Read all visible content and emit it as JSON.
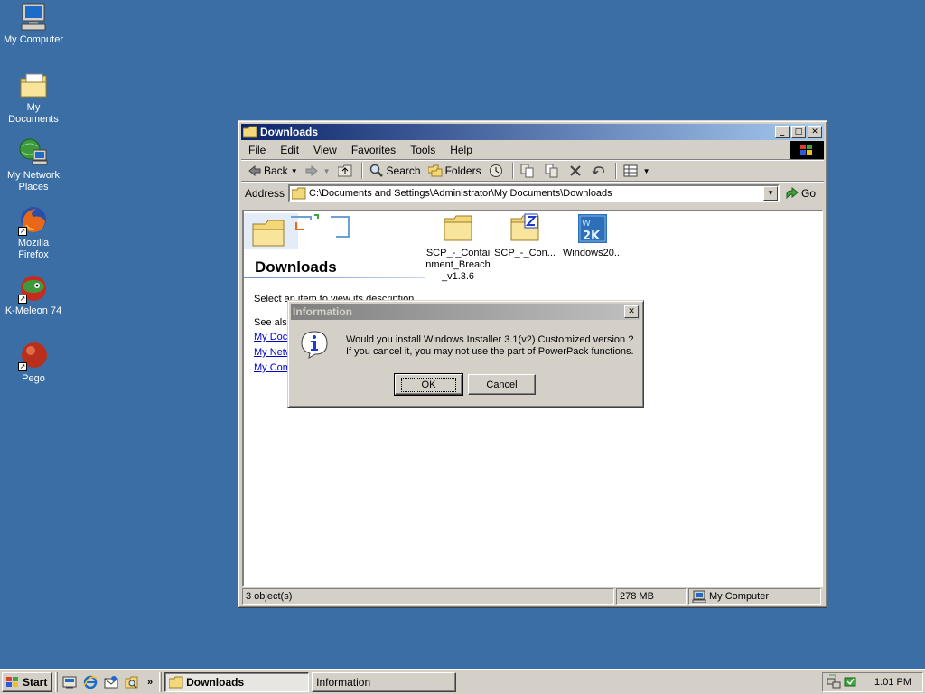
{
  "desktop": {
    "icons": [
      {
        "label": "My Computer",
        "icon": "computer-icon"
      },
      {
        "label": "My Documents",
        "icon": "documents-folder-icon"
      },
      {
        "label": "My Network Places",
        "icon": "network-icon"
      },
      {
        "label": "Mozilla Firefox",
        "icon": "firefox-icon"
      },
      {
        "label": "K-Meleon 74",
        "icon": "kmeleon-icon"
      },
      {
        "label": "Pego",
        "icon": "pego-icon"
      }
    ],
    "background": "#3a6ea5"
  },
  "window": {
    "title": "Downloads",
    "menu": [
      "File",
      "Edit",
      "View",
      "Favorites",
      "Tools",
      "Help"
    ],
    "toolbar": {
      "back": "Back",
      "search": "Search",
      "folders": "Folders"
    },
    "address": {
      "label": "Address",
      "value": "C:\\Documents and Settings\\Administrator\\My Documents\\Downloads",
      "go": "Go"
    },
    "pane": {
      "title": "Downloads",
      "description": "Select an item to view its description.",
      "see_also": "See also:",
      "links": [
        "My Documents",
        "My Network Places",
        "My Computer"
      ]
    },
    "files": [
      {
        "label": "SCP_-_Containment_Breach_v1.3.6",
        "lines": [
          "SCP_-_Contai",
          "nment_Breach",
          "_v1.3.6"
        ],
        "icon": "folder-icon"
      },
      {
        "label": "SCP_-_Con...",
        "lines": [
          "SCP_-_Con..."
        ],
        "icon": "zip-folder-icon"
      },
      {
        "label": "Windows20...",
        "lines": [
          "Windows20..."
        ],
        "icon": "windows-installer-icon"
      }
    ],
    "status": {
      "objects": "3 object(s)",
      "size": "278 MB",
      "zone": "My Computer"
    }
  },
  "dialog": {
    "title": "Information",
    "message_line1": "Would you install Windows Installer 3.1(v2) Customized version ?",
    "message_line2": "If you cancel it, you may not use the part of PowerPack functions.",
    "ok": "OK",
    "cancel": "Cancel"
  },
  "taskbar": {
    "start": "Start",
    "quicklaunch_more": "»",
    "tasks": [
      {
        "label": "Downloads",
        "active": true
      },
      {
        "label": "Information",
        "active": false
      }
    ],
    "clock": "1:01 PM"
  },
  "colors": {
    "title_active_start": "#0a246a",
    "title_active_end": "#a6caf0",
    "face": "#d4d0c8",
    "link": "#0000cc"
  }
}
